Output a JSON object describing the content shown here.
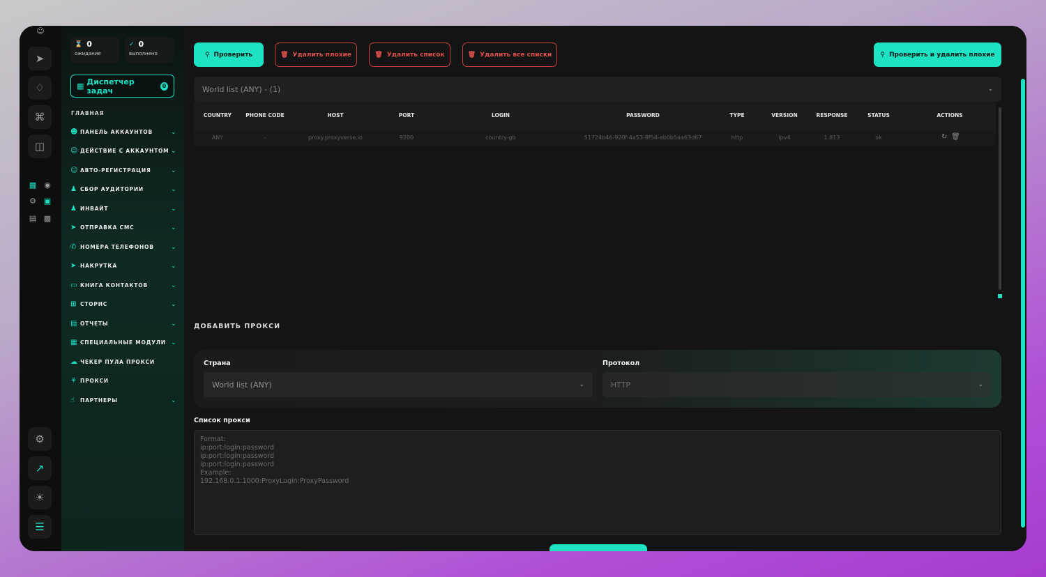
{
  "counters": {
    "waiting": {
      "value": "0",
      "label": "ожидание"
    },
    "done": {
      "value": "0",
      "label": "выполнено"
    }
  },
  "task_manager": {
    "label": "Диспетчер задач",
    "badge": "0"
  },
  "sidebar": {
    "section": "ГЛАВНАЯ",
    "items": [
      {
        "label": "ПАНЕЛЬ АККАУНТОВ",
        "icon": "users-icon"
      },
      {
        "label": "ДЕЙСТВИЕ С АККАУНТОМ",
        "icon": "user-icon"
      },
      {
        "label": "АВТО-РЕГИСТРАЦИЯ",
        "icon": "user-plus-icon"
      },
      {
        "label": "СБОР АУДИТОРИИ",
        "icon": "audience-icon"
      },
      {
        "label": "ИНВАЙТ",
        "icon": "invite-icon"
      },
      {
        "label": "ОТПРАВКА СМС",
        "icon": "send-icon"
      },
      {
        "label": "НОМЕРА ТЕЛЕФОНОВ",
        "icon": "phone-icon"
      },
      {
        "label": "НАКРУТКА",
        "icon": "boost-icon"
      },
      {
        "label": "КНИГА КОНТАКТОВ",
        "icon": "book-icon"
      },
      {
        "label": "СТОРИС",
        "icon": "stories-icon"
      },
      {
        "label": "ОТЧЕТЫ",
        "icon": "report-icon"
      },
      {
        "label": "СПЕЦИАЛЬНЫЕ МОДУЛИ",
        "icon": "modules-icon"
      },
      {
        "label": "ЧЕКЕР ПУЛА ПРОКСИ",
        "icon": "checker-icon"
      },
      {
        "label": "ПРОКСИ",
        "icon": "proxy-icon"
      },
      {
        "label": "ПАРТНЕРЫ",
        "icon": "partners-icon"
      }
    ]
  },
  "toolbar": {
    "check": "Проверить",
    "delete_bad": "Удалить плохие",
    "delete_list": "Удалить список",
    "delete_all": "Удалить все списки",
    "check_delete": "Проверить и удалить плохие"
  },
  "list_select": {
    "value": "World list (ANY) - (1)"
  },
  "table": {
    "headers": [
      "COUNTRY",
      "PHONE CODE",
      "HOST",
      "PORT",
      "LOGIN",
      "PASSWORD",
      "TYPE",
      "VERSION",
      "RESPONSE",
      "STATUS",
      "ACTIONS"
    ],
    "rows": [
      [
        "ANY",
        "-",
        "proxy.proxyverse.io",
        "9200",
        "country-gb",
        "51724b46-920f-4a53-8f54-eb0b5aa63d67",
        "http",
        "ipv4",
        "1.813",
        "ok"
      ]
    ]
  },
  "add_proxy": {
    "title": "ДОБАВИТЬ ПРОКСИ",
    "country_label": "Страна",
    "country_value": "World list (ANY)",
    "protocol_label": "Протокол",
    "protocol_value": "HTTP",
    "list_label": "Список прокси",
    "placeholder": "Format:\nip:port:login:password\nip:port:login:password\nip:port:login:password\nExample:\n192.168.0.1:1000:ProxyLogin:ProxyPassword"
  },
  "colors": {
    "accent": "#1de2c4",
    "danger": "#e0504b",
    "background": "#141414"
  }
}
